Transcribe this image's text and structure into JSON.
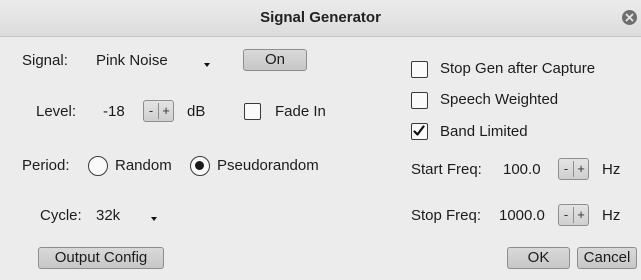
{
  "window": {
    "title": "Signal Generator",
    "close_icon": "close-icon"
  },
  "signal": {
    "label": "Signal:",
    "selected": "Pink Noise",
    "toggle_label": "On"
  },
  "level": {
    "label": "Level:",
    "value": "-18",
    "minus": "-",
    "plus": "+",
    "unit": "dB"
  },
  "fade_in": {
    "label": "Fade In",
    "checked": false
  },
  "period": {
    "label": "Period:",
    "options": [
      {
        "label": "Random",
        "selected": false
      },
      {
        "label": "Pseudorandom",
        "selected": true
      }
    ]
  },
  "cycle": {
    "label": "Cycle:",
    "selected": "32k"
  },
  "output_config": {
    "label": "Output Config"
  },
  "options": {
    "stop_gen": {
      "label": "Stop Gen after Capture",
      "checked": false
    },
    "speech_weighted": {
      "label": "Speech Weighted",
      "checked": false
    },
    "band_limited": {
      "label": "Band Limited",
      "checked": true
    }
  },
  "start_freq": {
    "label": "Start Freq:",
    "value": "100.0",
    "minus": "-",
    "plus": "+",
    "unit": "Hz"
  },
  "stop_freq": {
    "label": "Stop Freq:",
    "value": "1000.0",
    "minus": "-",
    "plus": "+",
    "unit": "Hz"
  },
  "footer": {
    "ok_label": "OK",
    "cancel_label": "Cancel"
  }
}
